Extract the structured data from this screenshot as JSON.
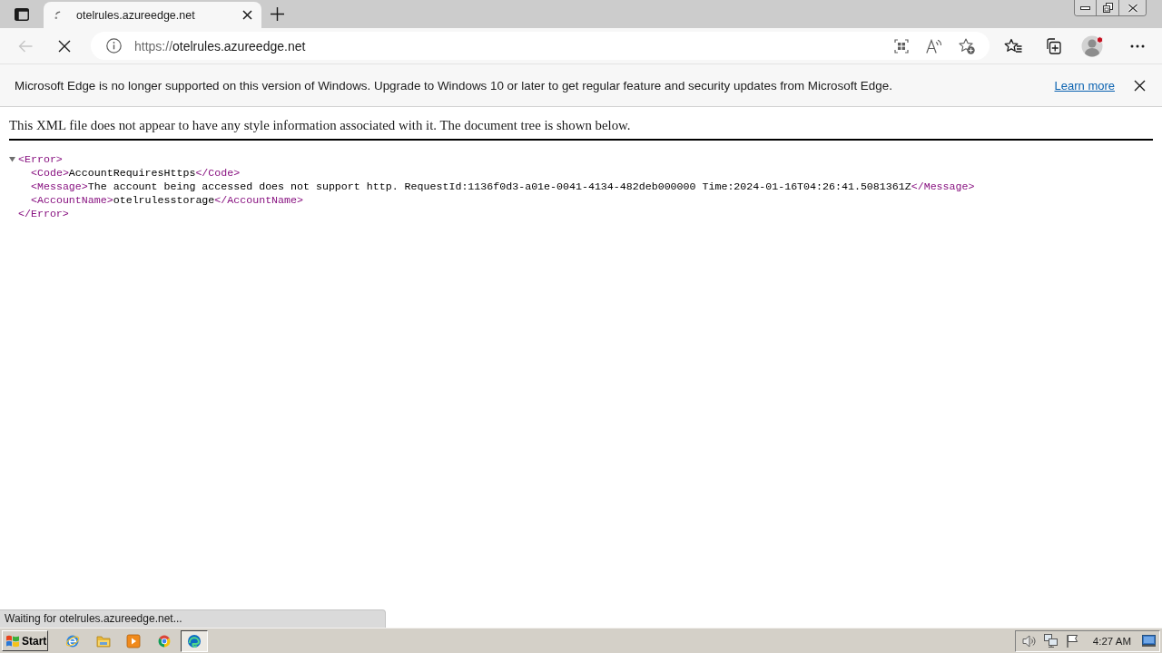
{
  "tab_strip": {
    "tabs": [
      {
        "title": "otelrules.azureedge.net",
        "selected": true
      }
    ]
  },
  "toolbar": {
    "back_button": {
      "disabled": true
    },
    "address": {
      "scheme": "https://",
      "host": "otelrules.azureedge.net"
    }
  },
  "infobar": {
    "message": "Microsoft Edge is no longer supported on this version of Windows. Upgrade to Windows 10 or later to get regular feature and security updates from Microsoft Edge.",
    "link": "Learn more"
  },
  "xml_viewer": {
    "notice": "This XML file does not appear to have any style information associated with it. The document tree is shown below.",
    "tree": {
      "open": "<Error>",
      "close": "</Error>",
      "expanded": true,
      "children": [
        {
          "open": "<Code>",
          "value": "AccountRequiresHttps",
          "close": "</Code>"
        },
        {
          "open": "<Message>",
          "value": "The account being accessed does not support http. RequestId:1136f0d3-a01e-0041-4134-482deb000000 Time:2024-01-16T04:26:41.5081361Z",
          "close": "</Message>"
        },
        {
          "open": "<AccountName>",
          "value": "otelrulesstorage",
          "close": "</AccountName>"
        }
      ]
    }
  },
  "status_bubble": {
    "text": "Waiting for otelrules.azureedge.net..."
  },
  "taskbar": {
    "start": "Start",
    "apps": [
      {
        "kind": "globe",
        "selected": false
      },
      {
        "kind": "folder",
        "selected": false
      },
      {
        "kind": "player",
        "selected": false
      },
      {
        "kind": "tricolor",
        "selected": false
      },
      {
        "kind": "swirl",
        "selected": true
      }
    ],
    "clock": "4:27 AM"
  }
}
